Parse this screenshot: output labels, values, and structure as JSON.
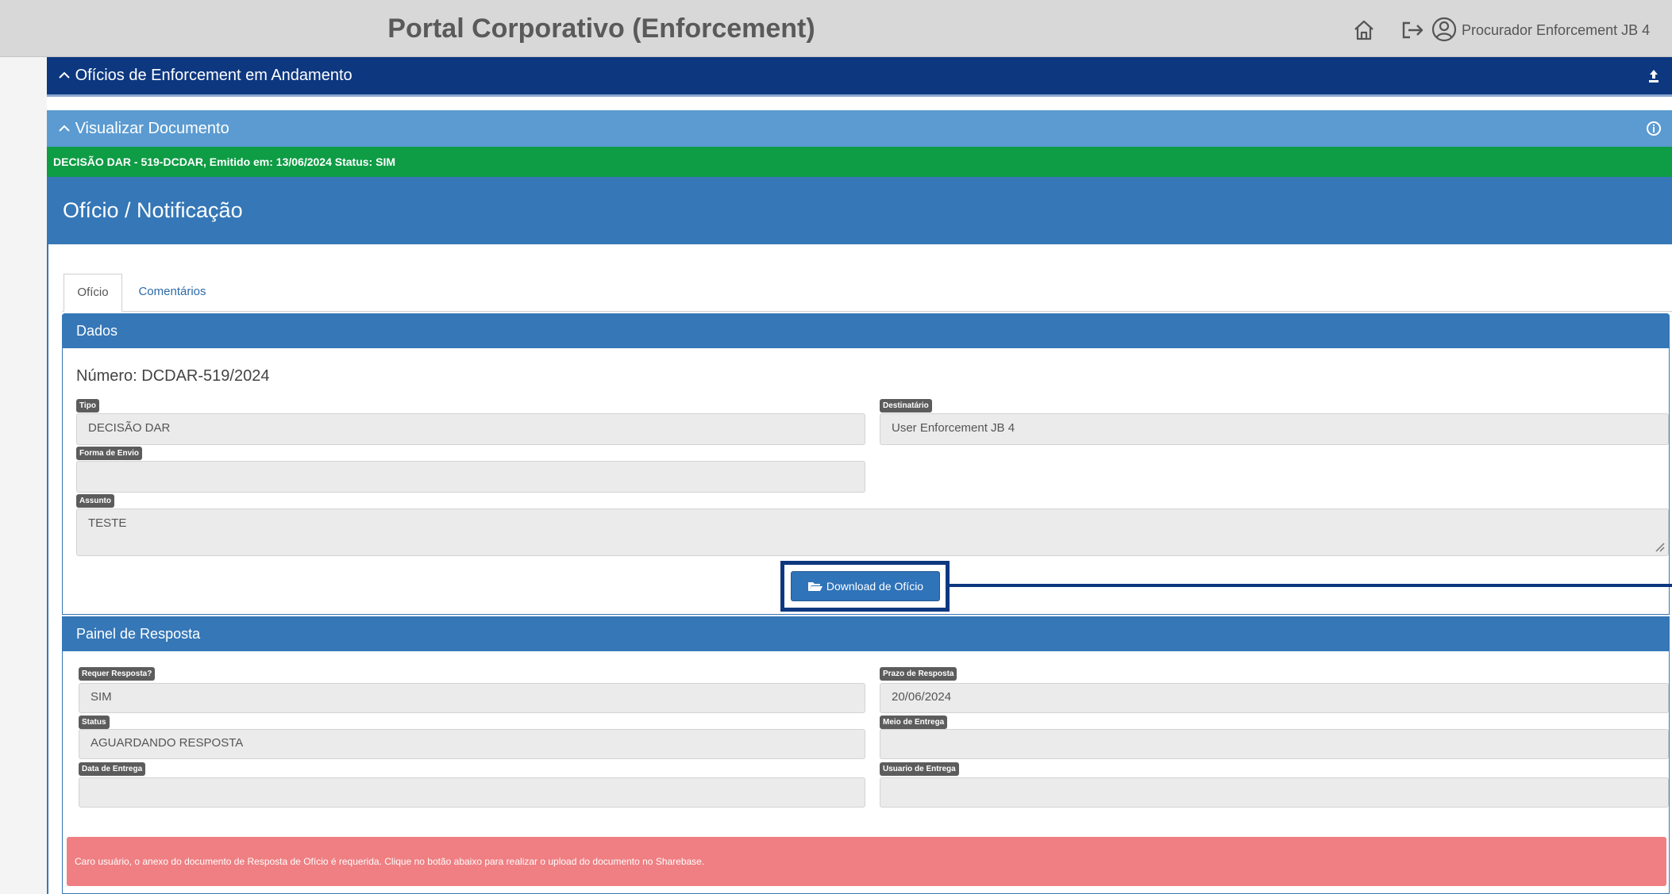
{
  "header": {
    "title": "Portal Corporativo (Enforcement)",
    "user_name": "Procurador Enforcement JB 4",
    "icons": [
      "home-icon",
      "logout-icon",
      "user-circle-icon"
    ]
  },
  "panels": {
    "oficios_label": "Ofícios de Enforcement em Andamento",
    "visualizar_label": "Visualizar Documento",
    "status_line": "DECISÃO DAR - 519-DCDAR, Emitido em: 13/06/2024 Status: SIM"
  },
  "document": {
    "title": "Ofício / Notificação",
    "tabs": [
      {
        "label": "Ofício"
      },
      {
        "label": "Comentários"
      }
    ]
  },
  "dados": {
    "section_title": "Dados",
    "numero": "Número: DCDAR-519/2024",
    "tipo_label": "Tipo",
    "tipo_value": "DECISÃO DAR",
    "destinatario_label": "Destinatário",
    "destinatario_value": "User Enforcement JB 4",
    "forma_envio_label": "Forma de Envio",
    "forma_envio_value": "",
    "assunto_label": "Assunto",
    "assunto_value": "TESTE",
    "download_label": "Download de Ofício"
  },
  "resposta": {
    "section_title": "Painel de Resposta",
    "requer_label": "Requer Resposta?",
    "requer_value": "SIM",
    "prazo_label": "Prazo de Resposta",
    "prazo_value": "20/06/2024",
    "status_label": "Status",
    "status_value": "AGUARDANDO RESPOSTA",
    "meio_label": "Meio de Entrega",
    "meio_value": "",
    "data_label": "Data de Entrega",
    "data_value": "",
    "usuario_label": "Usuario de Entrega",
    "usuario_value": "",
    "alert": "Caro usuário, o anexo do documento de Resposta de Ofício é requerida. Clique no botão abaixo para realizar o upload do documento no Sharebase."
  },
  "colors": {
    "navy_header": "#0d3880",
    "light_blue_header": "#5b9bd1",
    "section_blue": "#3577b7",
    "status_green": "#0e9c45",
    "alert_red": "#ef7f82",
    "callout": "#0d3880"
  }
}
